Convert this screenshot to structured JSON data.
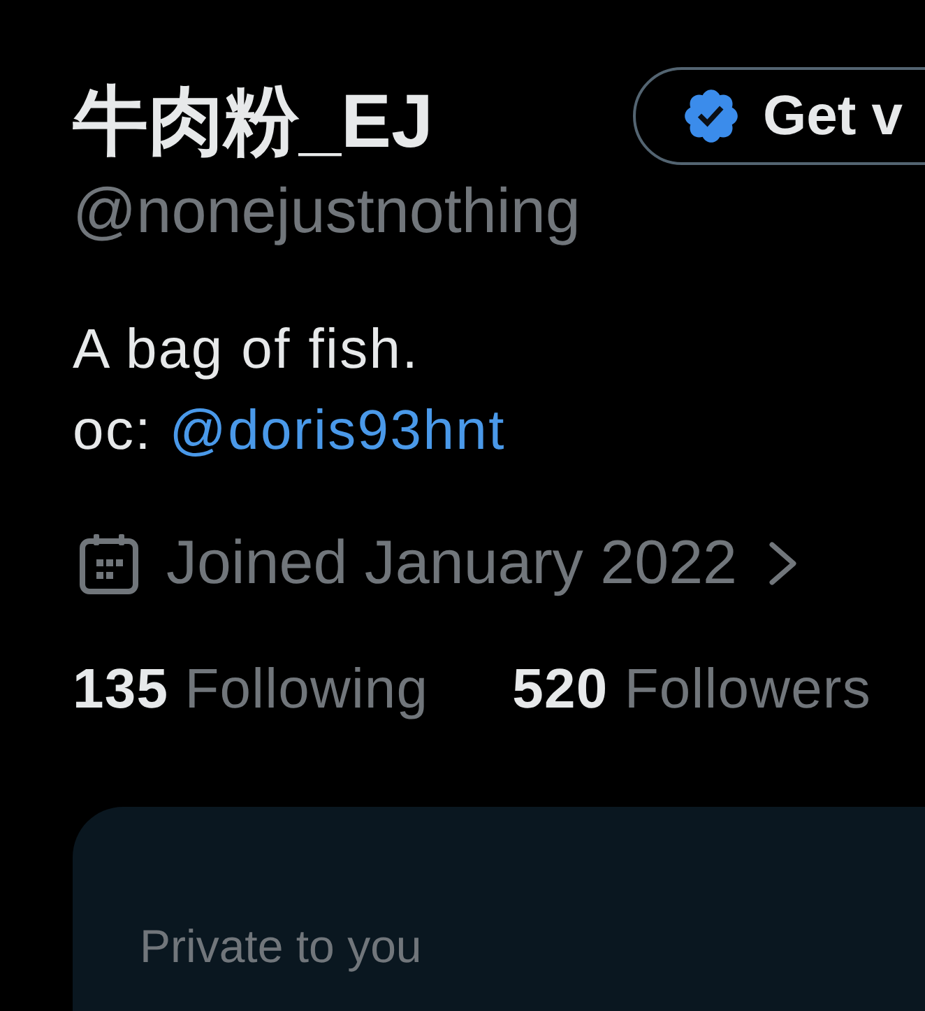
{
  "profile": {
    "name": "牛肉粉_EJ",
    "handle": "@nonejustnothing"
  },
  "verify_button": {
    "label": "Get v"
  },
  "bio": {
    "lines": [
      [
        {
          "kind": "text",
          "text": "A bag of fish."
        }
      ],
      [
        {
          "kind": "text",
          "text": "oc:"
        },
        {
          "kind": "link",
          "text": "@doris93hnt"
        }
      ]
    ]
  },
  "joined": {
    "text": "Joined January 2022"
  },
  "stats": [
    {
      "text": "**135** Following"
    },
    {
      "text": "**520** Followers"
    }
  ],
  "private_card": {
    "caption": "Private to you"
  }
}
